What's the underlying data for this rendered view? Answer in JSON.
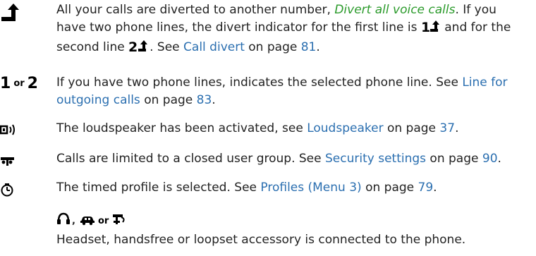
{
  "entries": {
    "divert": {
      "icon": "divert-arrow-icon",
      "t1": "All your calls are diverted to another number, ",
      "ital": "Divert all voice calls",
      "t2": ". If you have two phone lines, the divert indicator for the first line is ",
      "line1_num": "1",
      "t3": " and for the second line ",
      "line2_num": "2",
      "t4": ". See ",
      "link": "Call divert",
      "t5": " on page ",
      "page": "81",
      "t6": "."
    },
    "lines": {
      "num1": "1",
      "or": "or",
      "num2": "2",
      "t1": "If you have two phone lines, indicates the selected phone line. See ",
      "link": "Line for outgoing calls",
      "t2": " on page ",
      "page": "83",
      "t3": "."
    },
    "speaker": {
      "icon": "loudspeaker-icon",
      "t1": "The loudspeaker has been activated, see ",
      "link": "Loudspeaker",
      "t2": " on page ",
      "page": "37",
      "t3": "."
    },
    "cug": {
      "icon": "closed-user-group-icon",
      "t1": "Calls are limited to a closed user group. See ",
      "link": "Security settings",
      "t2": " on page ",
      "page": "90",
      "t3": "."
    },
    "timed": {
      "icon": "clock-icon",
      "t1": "The timed profile is selected. See ",
      "link": "Profiles (Menu 3)",
      "t2": " on page ",
      "page": "79",
      "t3": "."
    },
    "accessory": {
      "icons": [
        "headset-icon",
        "handsfree-car-icon",
        "loopset-icon"
      ],
      "sep_comma": ",",
      "sep_or": "or",
      "text": "Headset, handsfree or loopset accessory is connected to the phone."
    }
  },
  "colors": {
    "link": "#2b6fb0",
    "italic_link": "#2a9a2a",
    "text": "#222222"
  }
}
